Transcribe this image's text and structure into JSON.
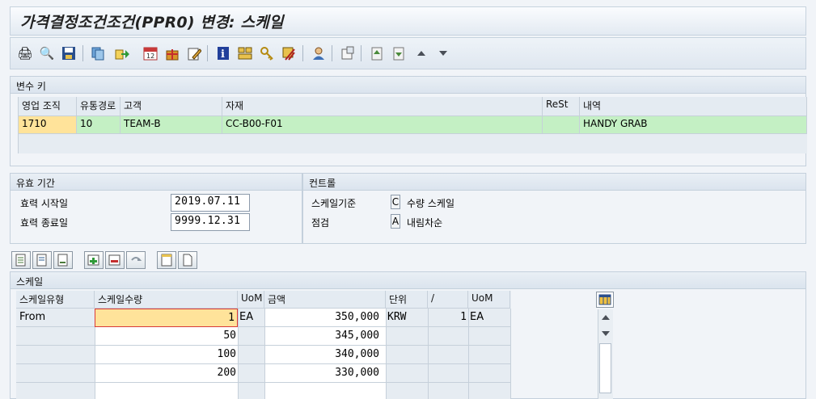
{
  "title": "가격결정조건조건(PPR0) 변경: 스케일",
  "toolbar": {
    "icons": [
      "print-icon",
      "find-icon",
      "save-icon",
      "copy-icon",
      "export-icon",
      "calendar-icon",
      "gift-icon",
      "edit-icon",
      "info-icon",
      "layout-icon",
      "key-icon",
      "scissors-icon",
      "user-icon",
      "window-icon",
      "doc-up-icon",
      "doc-down-icon",
      "arrow-up-icon",
      "arrow-down-icon"
    ]
  },
  "variable_key": {
    "section_title": "변수 키",
    "columns": [
      "영업 조직",
      "유통경로",
      "고객",
      "자재",
      "ReSt",
      "내역"
    ],
    "row": [
      "1710",
      "10",
      "TEAM-B",
      "CC-B00-F01",
      "",
      "HANDY GRAB"
    ]
  },
  "validity": {
    "section_title": "유효 기간",
    "start_label": "효력 시작일",
    "start_value": "2019.07.11",
    "end_label": "효력 종료일",
    "end_value": "9999.12.31"
  },
  "control": {
    "section_title": "컨트롤",
    "scale_basis_label": "스케일기준",
    "scale_basis_code": "C",
    "scale_basis_text": "수량 스케일",
    "check_label": "점검",
    "check_code": "A",
    "check_text": "내림차순"
  },
  "scale": {
    "section_title": "스케일",
    "columns": [
      "스케일유형",
      "스케일수량",
      "UoM",
      "금액",
      "단위",
      "/",
      "UoM"
    ],
    "rows": [
      {
        "type": "From",
        "qty": "1",
        "uom": "EA",
        "amount": "350,000",
        "unit": "KRW",
        "per": "1",
        "uom2": "EA"
      },
      {
        "type": "",
        "qty": "50",
        "uom": "",
        "amount": "345,000",
        "unit": "",
        "per": "",
        "uom2": ""
      },
      {
        "type": "",
        "qty": "100",
        "uom": "",
        "amount": "340,000",
        "unit": "",
        "per": "",
        "uom2": ""
      },
      {
        "type": "",
        "qty": "200",
        "uom": "",
        "amount": "330,000",
        "unit": "",
        "per": "",
        "uom2": ""
      }
    ]
  }
}
